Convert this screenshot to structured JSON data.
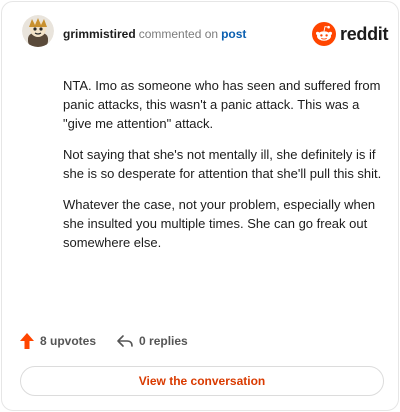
{
  "comment": {
    "username": "grimmistired",
    "verb": "commented on",
    "post_link": "post",
    "paragraphs": [
      "NTA. Imo as someone who has seen and suffered from panic attacks, this wasn't a panic attack. This was a \"give me attention\" attack.",
      "Not saying that she's not mentally ill, she definitely is if she is so desperate for attention that she'll pull this shit.",
      "Whatever the case, not your problem, especially when she insulted you multiple times. She can go freak out somewhere else."
    ]
  },
  "brand": {
    "wordmark": "reddit",
    "accent": "#ff4500"
  },
  "stats": {
    "upvotes": "8 upvotes",
    "replies": "0 replies"
  },
  "cta": {
    "label": "View the conversation"
  },
  "icons": {
    "upvote": "upvote-arrow-icon",
    "reply": "reply-arrow-icon",
    "logo": "reddit-snoo-icon",
    "avatar": "user-avatar"
  }
}
